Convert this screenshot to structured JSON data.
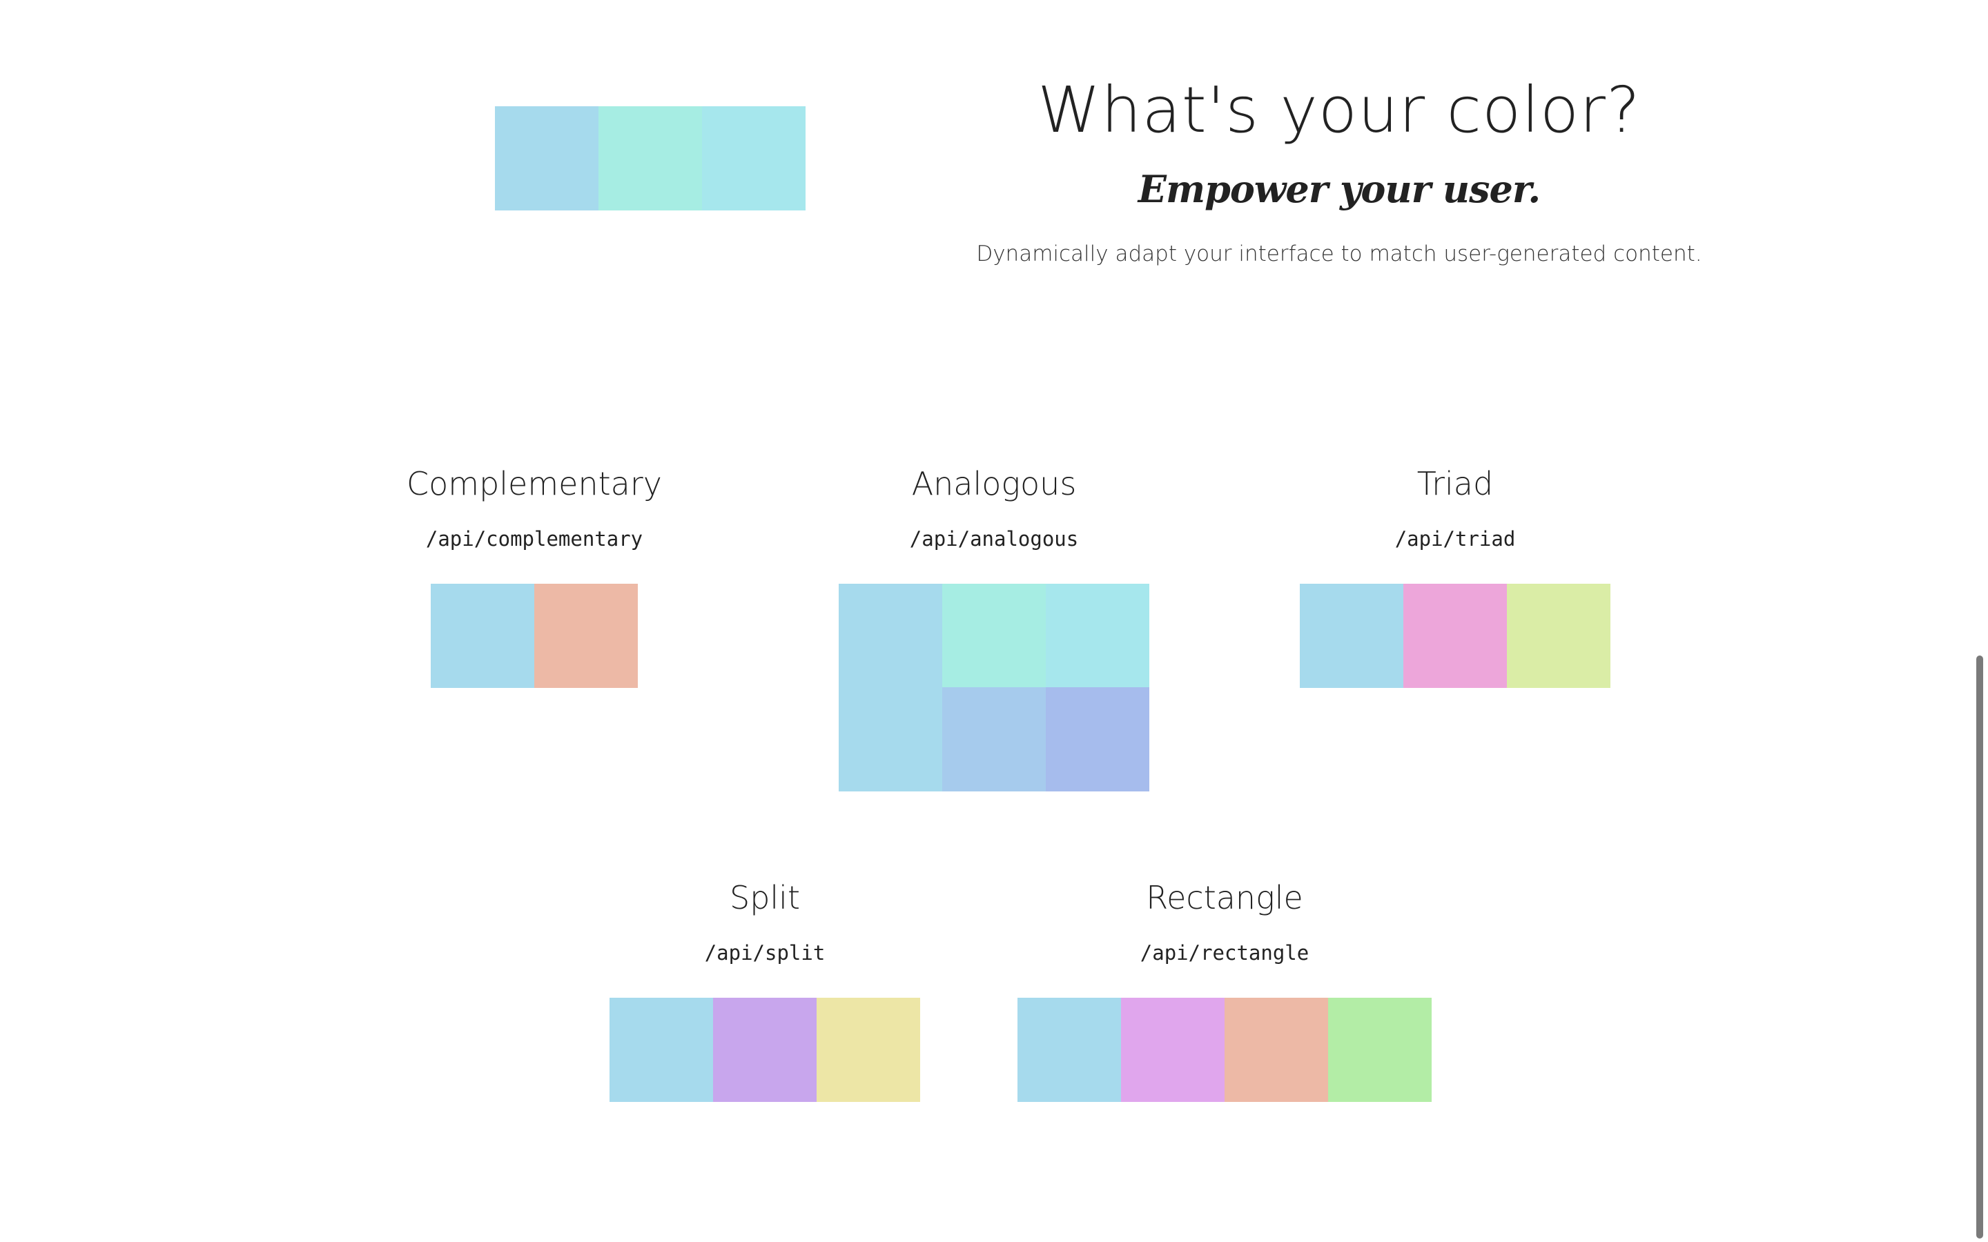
{
  "hero": {
    "title": "What's your color?",
    "tagline": "Empower your user.",
    "description": "Dynamically adapt your interface to match user-generated content.",
    "swatches": [
      "#a6daed",
      "#a6ede3",
      "#a6e7ed"
    ]
  },
  "sections": {
    "complementary": {
      "title": "Complementary",
      "endpoint": "/api/complementary",
      "swatches": [
        "#a6daed",
        "#edb9a6"
      ]
    },
    "analogous": {
      "title": "Analogous",
      "endpoint": "/api/analogous",
      "swatches": [
        "#a6daed",
        "#a6ede3",
        "#a6e7ed",
        "#a6cbed",
        "#a6bced"
      ]
    },
    "triad": {
      "title": "Triad",
      "endpoint": "/api/triad",
      "swatches": [
        "#a6daed",
        "#eda6da",
        "#daeda6"
      ]
    },
    "split": {
      "title": "Split",
      "endpoint": "/api/split",
      "swatches": [
        "#a6daed",
        "#c8a6ed",
        "#ede6a6"
      ]
    },
    "rectangle": {
      "title": "Rectangle",
      "endpoint": "/api/rectangle",
      "swatches": [
        "#a6daed",
        "#e0a6ed",
        "#edb9a6",
        "#b3eda6"
      ]
    }
  }
}
